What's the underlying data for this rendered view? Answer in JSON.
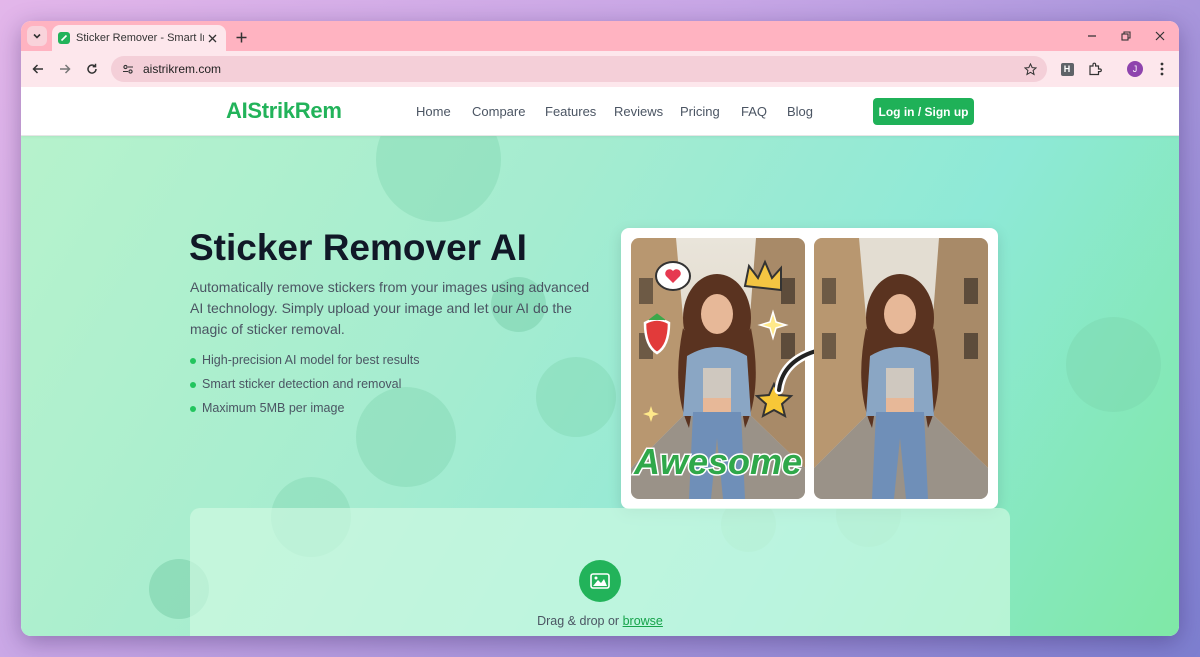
{
  "browser": {
    "tab_title": "Sticker Remover - Smart Image",
    "url": "aistrikrem.com",
    "extension_label": "H",
    "profile_initial": "J"
  },
  "site": {
    "logo": "AIStrikRem",
    "nav": [
      "Home",
      "Compare",
      "Features",
      "Reviews",
      "Pricing",
      "FAQ",
      "Blog"
    ],
    "login_label": "Log in / Sign up"
  },
  "hero": {
    "title": "Sticker Remover AI",
    "description": "Automatically remove stickers from your images using advanced AI technology. Simply upload your image and let our AI do the magic of sticker removal.",
    "features": [
      "High-precision AI model for best results",
      "Smart sticker detection and removal",
      "Maximum 5MB per image"
    ],
    "sticker_word": "Awesome"
  },
  "upload": {
    "text": "Drag & drop or",
    "browse": "browse"
  },
  "colors": {
    "brand": "#22b35a",
    "tab_strip": "#ffb3c1"
  }
}
